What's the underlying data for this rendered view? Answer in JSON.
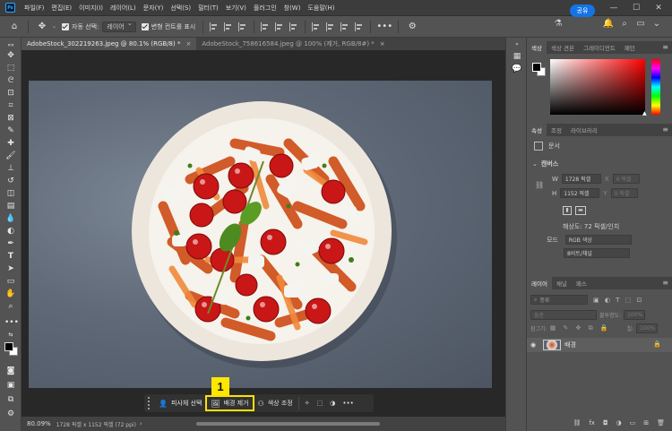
{
  "app": {
    "logo_text": "Ps"
  },
  "menu": [
    "파일(F)",
    "편집(E)",
    "이미지(I)",
    "레이어(L)",
    "문자(Y)",
    "선택(S)",
    "필터(T)",
    "보기(V)",
    "플러그인",
    "창(W)",
    "도움말(H)"
  ],
  "window_controls": [
    "—",
    "☐",
    "✕"
  ],
  "options": {
    "auto_select_label": "자동 선택:",
    "auto_select_value": "레이어",
    "transform_label": "변형 컨트롤 표시",
    "share_label": "공유"
  },
  "tabs": [
    {
      "label": "AdobeStock_302219263.jpeg @ 80.1% (RGB/8) *",
      "active": true
    },
    {
      "label": "AdobeStock_758616584.jpeg @ 100% (제거, RGB/8#) *",
      "active": false
    }
  ],
  "tab_close": "×",
  "context_bar": {
    "subject_label": "피사체 선택",
    "remove_bg_label": "배경 제거",
    "color_adjust_label": "색상 조정",
    "more": "•••"
  },
  "annotation": {
    "number": "1"
  },
  "status": {
    "zoom": "80.09%",
    "info": "1728 픽셀 x 1152 픽셀 (72 ppi)"
  },
  "color_panel": {
    "tabs": [
      "색상",
      "색상 견본",
      "그레이디언트",
      "패턴"
    ]
  },
  "properties_panel": {
    "tabs": [
      "속성",
      "조정",
      "라이브러리"
    ],
    "doc_label": "문서",
    "canvas_label": "캔버스",
    "w_label": "W",
    "w_value": "1728 픽셀",
    "h_label": "H",
    "h_value": "1152 픽셀",
    "x_label": "X",
    "x_value": "0 픽셀",
    "y_label": "Y",
    "y_value": "0 픽셀",
    "resolution": "해상도: 72 픽셀/인치",
    "mode_label": "모드",
    "mode_value": "RGB 색상",
    "bits_value": "8비트/채널"
  },
  "layers_panel": {
    "tabs": [
      "레이어",
      "채널",
      "패스"
    ],
    "search_placeholder": "종류",
    "blend_mode": "표준",
    "opacity_label": "불투명도:",
    "opacity_value": "100%",
    "lock_label": "잠그기:",
    "fill_label": "칠:",
    "fill_value": "100%",
    "layer_name": "배경"
  },
  "layer_footer_icons": [
    "link-icon",
    "fx-icon",
    "mask-icon",
    "adjustment-icon",
    "group-icon",
    "new-layer-icon",
    "trash-icon"
  ],
  "colors": {
    "accent": "#1473e6",
    "highlight": "#ffe000"
  }
}
